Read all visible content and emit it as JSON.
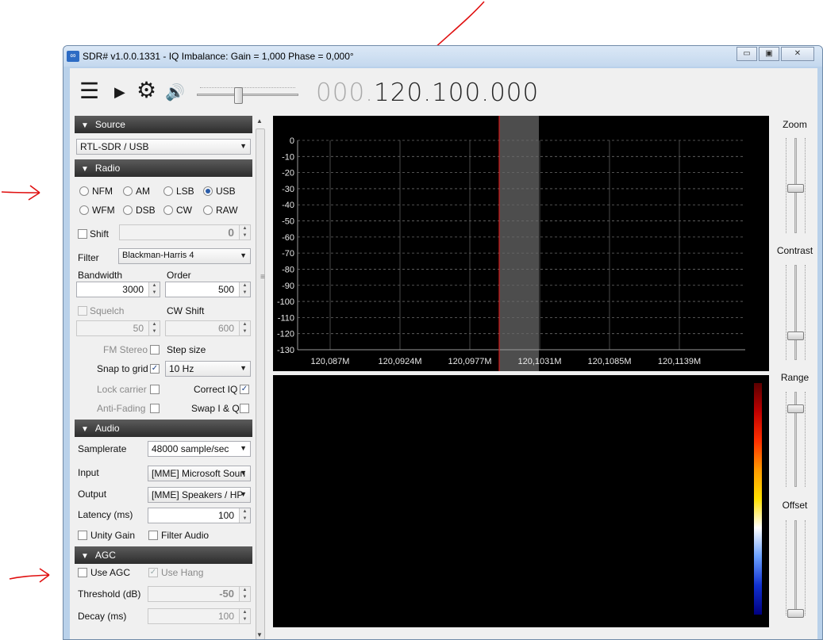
{
  "window": {
    "title": "SDR# v1.0.0.1331 - IQ Imbalance: Gain = 1,000 Phase = 0,000°",
    "logo_glyph": "∞",
    "buttons": [
      "▭",
      "▣",
      "✕"
    ]
  },
  "toolbar": {
    "menu_glyph": "☰",
    "play_glyph": "▶",
    "settings_glyph": "⚙",
    "volume_glyph": "🔊",
    "volume_level": 0.4,
    "frequency_prefix": "000.",
    "frequency_main": "120.100.000"
  },
  "source": {
    "header": "Source",
    "selected": "RTL-SDR / USB"
  },
  "radio": {
    "header": "Radio",
    "modes": [
      "NFM",
      "AM",
      "LSB",
      "USB",
      "WFM",
      "DSB",
      "CW",
      "RAW"
    ],
    "selected_mode": "USB",
    "shift_label": "Shift",
    "shift_value": "0",
    "filter_label": "Filter",
    "filter_value": "Blackman-Harris 4",
    "bandwidth_label": "Bandwidth",
    "bandwidth_value": "3000",
    "order_label": "Order",
    "order_value": "500",
    "squelch_label": "Squelch",
    "squelch_value": "50",
    "cwshift_label": "CW Shift",
    "cwshift_value": "600",
    "fmstereo_label": "FM Stereo",
    "stepsize_label": "Step size",
    "snap_label": "Snap to grid",
    "snap_checked": true,
    "stepsize_value": "10 Hz",
    "lockcarrier_label": "Lock carrier",
    "correctiq_label": "Correct IQ",
    "correctiq_checked": true,
    "antifading_label": "Anti-Fading",
    "swapiq_label": "Swap I & Q"
  },
  "audio": {
    "header": "Audio",
    "samplerate_label": "Samplerate",
    "samplerate_value": "48000 sample/sec",
    "input_label": "Input",
    "input_value": "[MME] Microsoft Soun",
    "output_label": "Output",
    "output_value": "[MME] Speakers / HP",
    "latency_label": "Latency (ms)",
    "latency_value": "100",
    "unitygain_label": "Unity Gain",
    "filteraudio_label": "Filter Audio"
  },
  "agc": {
    "header": "AGC",
    "useagc_label": "Use AGC",
    "usehang_label": "Use Hang",
    "usehang_checked": true,
    "threshold_label": "Threshold (dB)",
    "threshold_value": "-50",
    "decay_label": "Decay (ms)",
    "decay_value": "100"
  },
  "spectrum": {
    "y_ticks": [
      "0",
      "-10",
      "-20",
      "-30",
      "-40",
      "-50",
      "-60",
      "-70",
      "-80",
      "-90",
      "-100",
      "-110",
      "-120",
      "-130"
    ],
    "x_ticks": [
      "120,087M",
      "120,0924M",
      "120,0977M",
      "120,1031M",
      "120,1085M",
      "120,1139M"
    ],
    "tuned_marker_color": "#d01818",
    "passband_color": "#5a5a5a"
  },
  "sliders": {
    "zoom_label": "Zoom",
    "contrast_label": "Contrast",
    "range_label": "Range",
    "offset_label": "Offset"
  },
  "annotations": {
    "arrow_color": "#e01010"
  }
}
